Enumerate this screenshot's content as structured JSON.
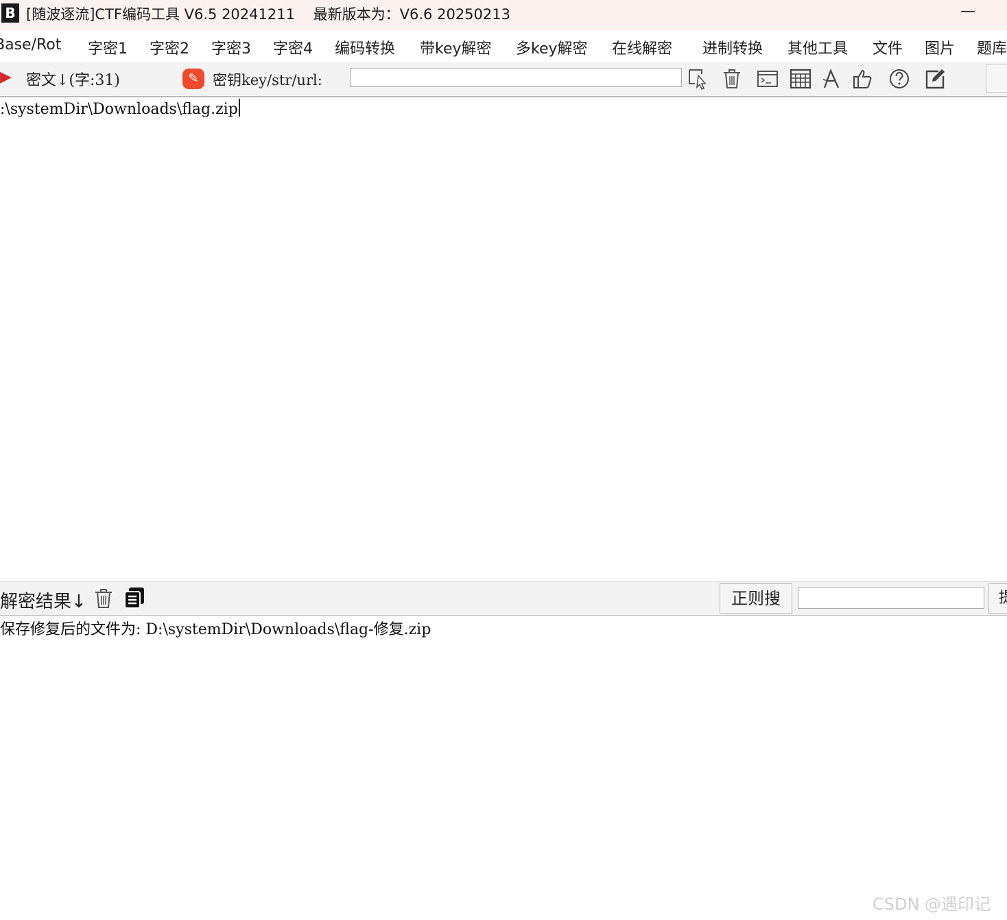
{
  "titlebar": {
    "app_icon_glyph": "B",
    "title": "[随波逐流]CTF编码工具 V6.5 20241211    最新版本为：V6.6 20250213",
    "minimize_glyph": "—"
  },
  "menu": {
    "items": [
      "Base/Rot",
      "字密1",
      "字密2",
      "字密3",
      "字密4",
      "编码转换",
      "带key解密",
      "多key解密",
      "在线解密",
      "进制转换",
      "其他工具",
      "文件",
      "图片",
      "题库"
    ]
  },
  "toolbar": {
    "cipher_label": "密文↓(字:31)",
    "key_label": "密钥key/str/url:",
    "key_value": "",
    "icons": [
      "select-cursor-icon",
      "trash-icon",
      "terminal-icon",
      "table-icon",
      "font-icon",
      "thumbs-up-icon",
      "help-icon",
      "edit-icon"
    ]
  },
  "cipher": {
    "text": ":\\systemDir\\Downloads\\flag.zip"
  },
  "result": {
    "label": "解密结果↓",
    "regex_button": "正则搜",
    "regex_value": "",
    "stub_button": "提",
    "text": "保存修复后的文件为: D:\\systemDir\\Downloads\\flag-修复.zip"
  },
  "watermark": "CSDN @遇印记"
}
